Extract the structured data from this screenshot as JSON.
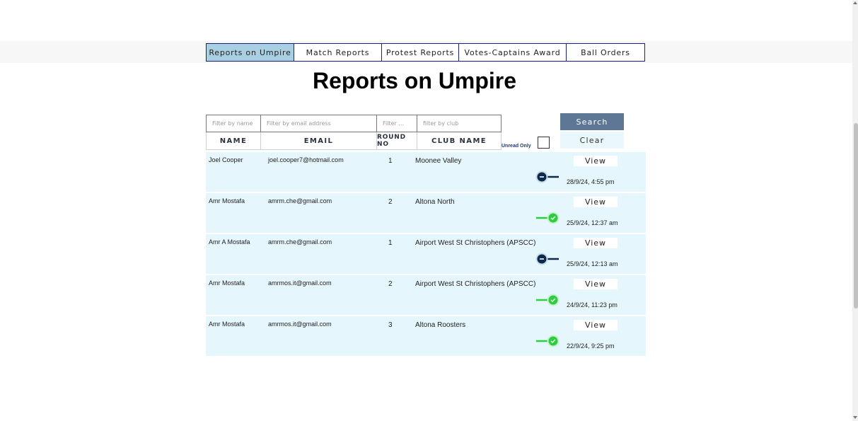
{
  "tabs": [
    {
      "label": "Reports on Umpire",
      "active": true
    },
    {
      "label": "Match Reports",
      "active": false
    },
    {
      "label": "Protest Reports",
      "active": false
    },
    {
      "label": "Votes-Captains Award",
      "active": false
    },
    {
      "label": "Ball Orders",
      "active": false
    }
  ],
  "page_title": "Reports on Umpire",
  "filters": {
    "name_placeholder": "Filter by name",
    "email_placeholder": "Filter by email address",
    "round_placeholder": "Filter ...",
    "club_placeholder": "filter by club"
  },
  "columns": {
    "name": "NAME",
    "email": "EMAIL",
    "round": "ROUND NO",
    "club": "CLUB NAME"
  },
  "unread_only_label": "Unread Only",
  "search_label": "Search",
  "clear_label": "Clear",
  "view_label": "View",
  "colors": {
    "toggle_on": "#2ecc40",
    "toggle_off": "#0d2a4a",
    "row_background": "#e6f6fd",
    "search_button": "#5e7794",
    "active_tab": "#a8cfe2"
  },
  "rows": [
    {
      "name": "Joel Cooper",
      "email": "joel.cooper7@hotmail.com",
      "round": "1",
      "club": "Moonee Valley",
      "read": false,
      "date": "28/9/24, 4:55 pm"
    },
    {
      "name": "Amr Mostafa",
      "email": "amrm.che@gmail.com",
      "round": "2",
      "club": "Altona North",
      "read": true,
      "date": "25/9/24, 12:37 am"
    },
    {
      "name": "Amr A Mostafa",
      "email": "amrm.che@gmail.com",
      "round": "1",
      "club": "Airport West St Christophers (APSCC)",
      "read": false,
      "date": "25/9/24, 12:13 am"
    },
    {
      "name": "Amr Mostafa",
      "email": "amrmos.it@gmail.com",
      "round": "2",
      "club": "Airport West St Christophers (APSCC)",
      "read": true,
      "date": "24/9/24, 11:23 pm"
    },
    {
      "name": "Amr Mostafa",
      "email": "amrmos.it@gmail.com",
      "round": "3",
      "club": "Altona Roosters",
      "read": true,
      "date": "22/9/24, 9:25 pm"
    }
  ]
}
